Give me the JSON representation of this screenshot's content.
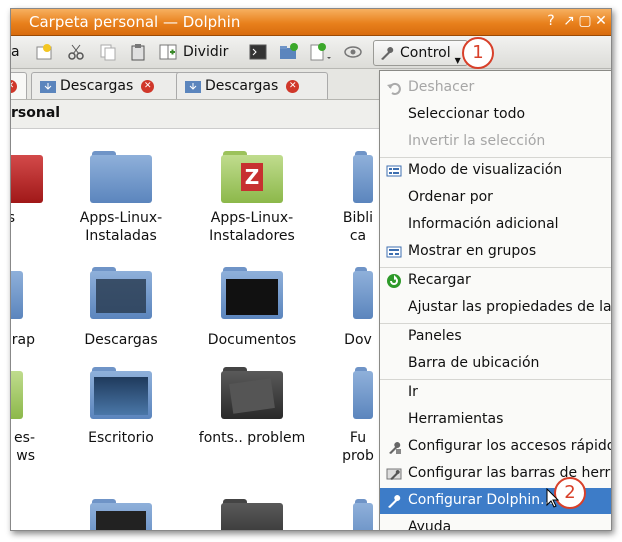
{
  "window": {
    "title": "Carpeta personal — Dolphin",
    "title_buttons": [
      "?",
      "↗",
      "▢",
      "✕"
    ]
  },
  "toolbar": {
    "partial_label": "a",
    "split_label": "Dividir",
    "control_label": "Control",
    "control_badge": "1"
  },
  "tabs": [
    {
      "label": "Descargas"
    },
    {
      "label": "Descargas"
    }
  ],
  "location": {
    "text": "rsonal"
  },
  "folders": [
    {
      "label": "Apps-Linux-\nInstaladas"
    },
    {
      "label": "Apps-Linux-\nInstaladores"
    },
    {
      "label": "Bibli\nca"
    },
    {
      "label": "rap"
    },
    {
      "label": "Descargas"
    },
    {
      "label": "Documentos"
    },
    {
      "label": "Dov"
    },
    {
      "label": "es-\nws"
    },
    {
      "label": "Escritorio"
    },
    {
      "label": "fonts.. problem"
    },
    {
      "label": "Fu\nprob"
    },
    {
      "label": "s"
    }
  ],
  "menu": {
    "items": [
      {
        "label": "Deshacer",
        "disabled": true,
        "icon": "undo-icon"
      },
      {
        "label": "Seleccionar todo",
        "disabled": false,
        "icon": ""
      },
      {
        "label": "Invertir la selección",
        "disabled": true,
        "icon": ""
      },
      {
        "label": "Modo de visualización",
        "disabled": false,
        "icon": "view-mode-icon"
      },
      {
        "label": "Ordenar por",
        "disabled": false,
        "icon": ""
      },
      {
        "label": "Información adicional",
        "disabled": false,
        "icon": ""
      },
      {
        "label": "Mostrar en grupos",
        "disabled": false,
        "icon": "groups-icon"
      },
      {
        "label": "Recargar",
        "disabled": false,
        "icon": "reload-icon"
      },
      {
        "label": "Ajustar las propiedades de la v",
        "disabled": false,
        "icon": ""
      },
      {
        "label": "Paneles",
        "disabled": false,
        "icon": ""
      },
      {
        "label": "Barra de ubicación",
        "disabled": false,
        "icon": ""
      },
      {
        "label": "Ir",
        "disabled": false,
        "icon": ""
      },
      {
        "label": "Herramientas",
        "disabled": false,
        "icon": ""
      },
      {
        "label": "Configurar los accesos rápidos",
        "disabled": false,
        "icon": "shortcuts-icon"
      },
      {
        "label": "Configurar las barras de herra",
        "disabled": false,
        "icon": "toolbars-icon"
      },
      {
        "label": "Configurar Dolphin...",
        "disabled": false,
        "icon": "wrench-icon",
        "highlighted": true
      },
      {
        "label": "Ayuda",
        "disabled": false,
        "icon": ""
      }
    ],
    "highlight_badge": "2"
  },
  "colors": {
    "titlebar": "#e8801c",
    "highlight": "#3d7cc8",
    "callout": "#d8402a"
  }
}
